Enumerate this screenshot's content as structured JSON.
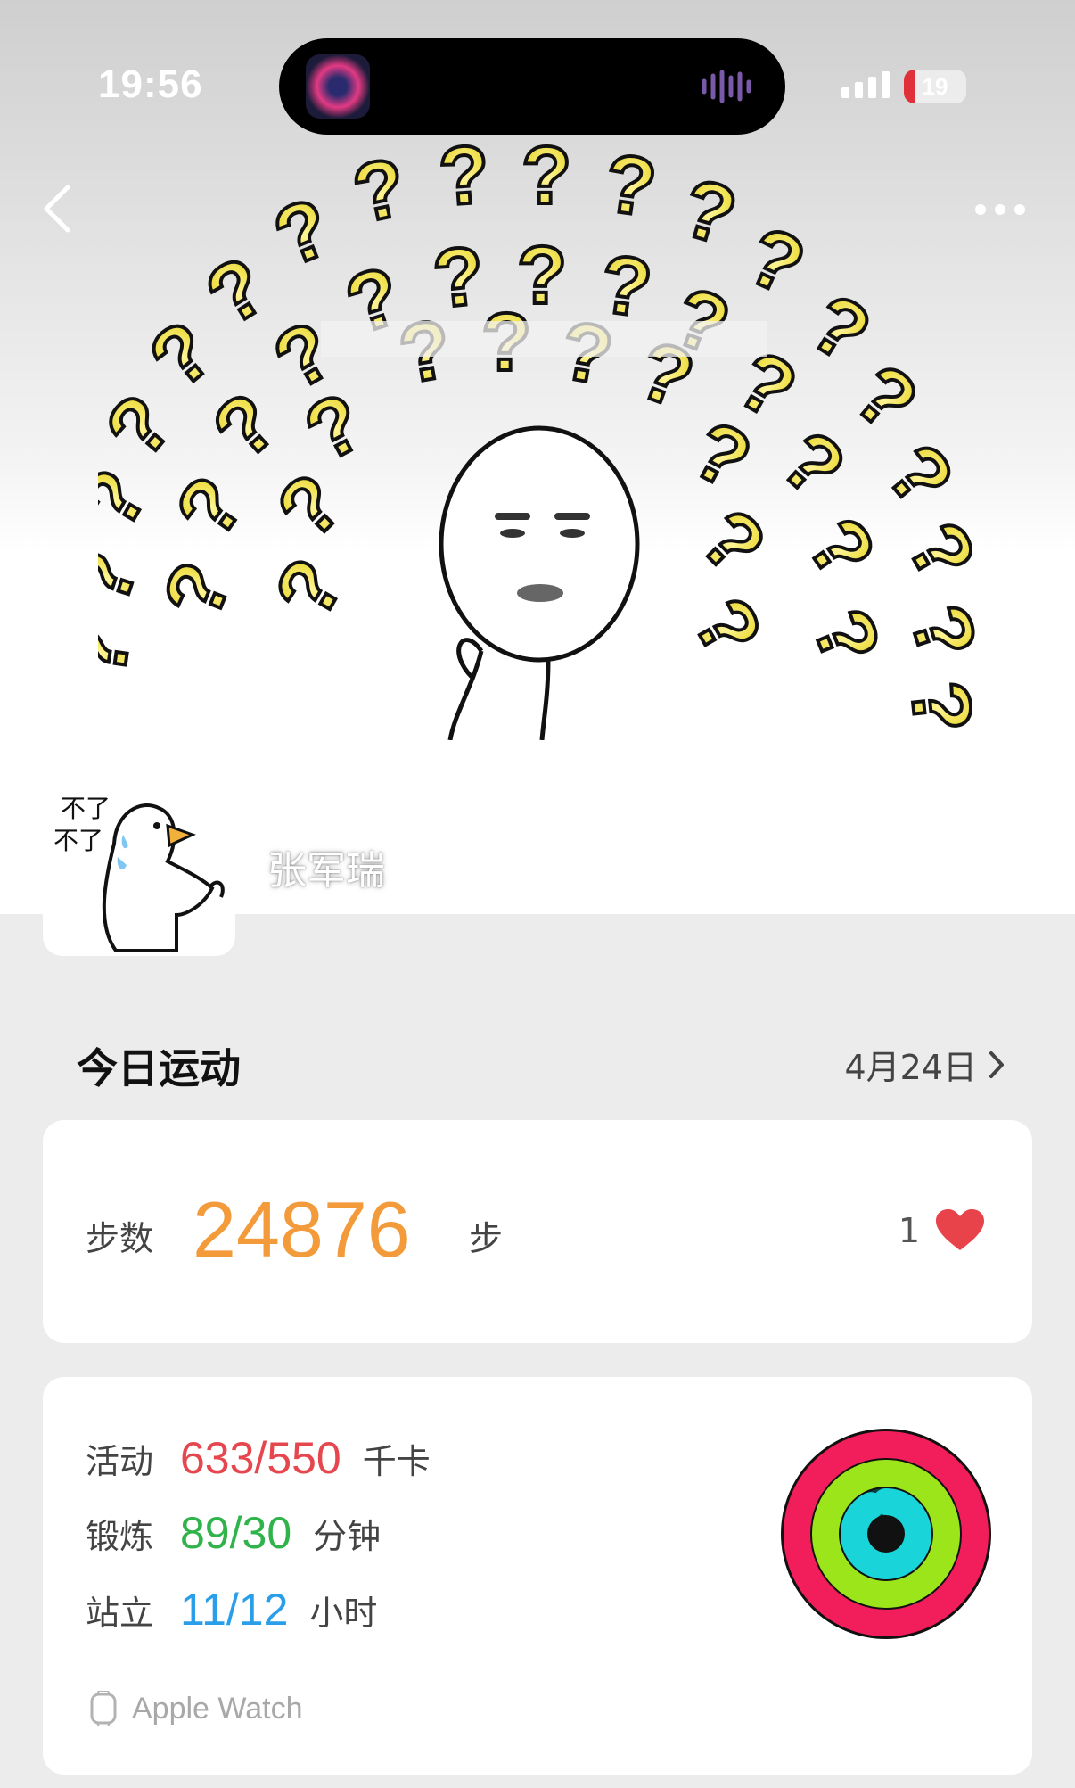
{
  "status_bar": {
    "time": "19:56",
    "battery": "19",
    "icons": [
      "now-playing-art",
      "audio-wave-icon",
      "signal-icon",
      "battery-icon"
    ]
  },
  "nav": {
    "back_icon": "chevron-left-icon",
    "more_icon": "more-dots-icon"
  },
  "profile": {
    "name": "张军瑞",
    "avatar_caption": "不了 不了"
  },
  "today": {
    "title": "今日运动",
    "date": "4月24日"
  },
  "steps": {
    "label": "步数",
    "value": "24876",
    "unit": "步",
    "likes": "1"
  },
  "activity": {
    "move": {
      "label": "活动",
      "value": "633/550",
      "unit": "千卡",
      "color": "#e6474f"
    },
    "exercise": {
      "label": "锻炼",
      "value": "89/30",
      "unit": "分钟",
      "color": "#2fb34a"
    },
    "stand": {
      "label": "站立",
      "value": "11/12",
      "unit": "小时",
      "color": "#2a9ee8"
    },
    "source": "Apple Watch",
    "rings": {
      "move_progress": 1.15,
      "exercise_progress": 1.0,
      "stand_progress": 0.92
    }
  },
  "colors": {
    "steps": "#f39a3a",
    "heart": "#e8434b",
    "move_ring": "#f21d5b",
    "exercise_ring": "#9be51a",
    "stand_ring": "#19d4d8"
  }
}
